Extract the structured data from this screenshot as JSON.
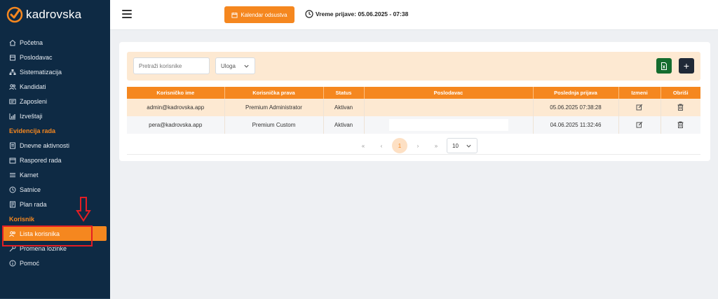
{
  "app": {
    "name": "kadrovska"
  },
  "sidebar": {
    "items": [
      {
        "label": "Početna",
        "icon": "home-icon"
      },
      {
        "label": "Poslodavac",
        "icon": "building-icon"
      },
      {
        "label": "Sistematizacija",
        "icon": "hierarchy-icon"
      },
      {
        "label": "Kandidati",
        "icon": "users-icon"
      },
      {
        "label": "Zaposleni",
        "icon": "id-card-icon"
      },
      {
        "label": "Izveštaji",
        "icon": "chart-icon"
      }
    ],
    "section_work": "Evidencija rada",
    "work_items": [
      {
        "label": "Dnevne aktivnosti",
        "icon": "document-icon"
      },
      {
        "label": "Raspored rada",
        "icon": "calendar-icon"
      },
      {
        "label": "Karnet",
        "icon": "list-icon"
      },
      {
        "label": "Satnice",
        "icon": "clock-icon"
      },
      {
        "label": "Plan rada",
        "icon": "plan-icon"
      }
    ],
    "section_user": "Korisnik",
    "user_items": [
      {
        "label": "Lista korisnika",
        "icon": "users-icon",
        "active": true
      },
      {
        "label": "Promena lozinke",
        "icon": "key-icon"
      },
      {
        "label": "Pomoć",
        "icon": "info-icon"
      }
    ]
  },
  "topbar": {
    "calendar_button": "Kalendar odsustva",
    "login_time": "Vreme prijave: 05.06.2025 - 07:38"
  },
  "toolbar": {
    "search_placeholder": "Pretraži korisnike",
    "role_select": "Uloga",
    "add_label": "+"
  },
  "table": {
    "headers": [
      "Korisničko ime",
      "Korisnička prava",
      "Status",
      "Poslodavac",
      "Poslednja prijava",
      "Izmeni",
      "Obriši"
    ],
    "rows": [
      {
        "username": "admin@kadrovska.app",
        "rights": "Premium Administrator",
        "status": "Aktivan",
        "employer": "",
        "last_login": "05.06.2025 07:38:28"
      },
      {
        "username": "pera@kadrovska.app",
        "rights": "Premium Custom",
        "status": "Aktivan",
        "employer": "",
        "last_login": "04.06.2025 11:32:46"
      }
    ]
  },
  "pagination": {
    "first": "«",
    "prev": "‹",
    "current_page": "1",
    "next": "›",
    "last": "»",
    "page_size": "10"
  },
  "colors": {
    "accent": "#f5871f",
    "sidebar_bg": "#0e2a44",
    "row_highlight": "#fde9d2",
    "annotation": "#e31e24"
  }
}
